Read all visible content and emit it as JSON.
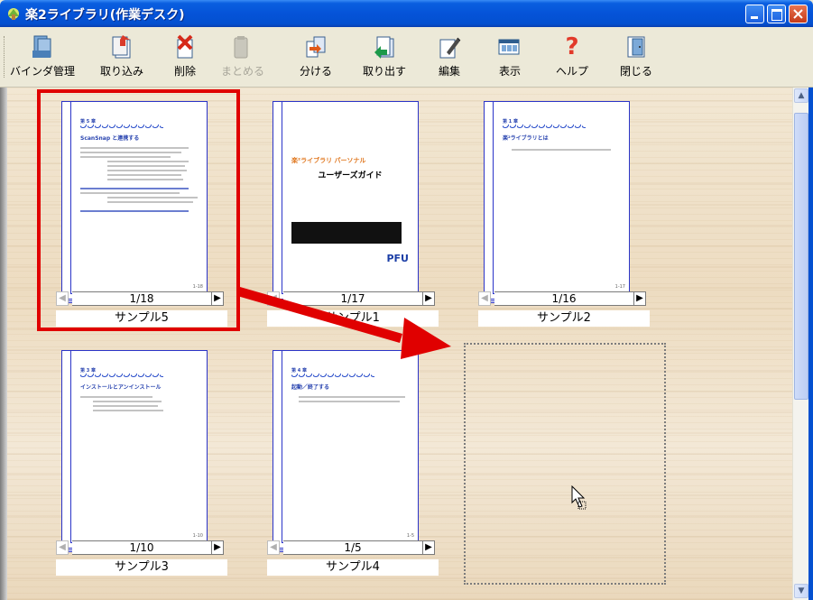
{
  "window": {
    "title": "楽2ライブラリ(作業デスク)"
  },
  "toolbar": {
    "items": [
      {
        "label": "バインダ管理",
        "icon": "binder-manage-icon",
        "enabled": true
      },
      {
        "label": "取り込み",
        "icon": "import-icon",
        "enabled": true
      },
      {
        "label": "削除",
        "icon": "delete-icon",
        "enabled": true
      },
      {
        "label": "まとめる",
        "icon": "merge-icon",
        "enabled": false
      },
      {
        "label": "分ける",
        "icon": "split-icon",
        "enabled": true
      },
      {
        "label": "取り出す",
        "icon": "extract-icon",
        "enabled": true
      },
      {
        "label": "編集",
        "icon": "edit-icon",
        "enabled": true
      },
      {
        "label": "表示",
        "icon": "view-icon",
        "enabled": true
      },
      {
        "label": "ヘルプ",
        "icon": "help-icon",
        "enabled": true
      },
      {
        "label": "閉じる",
        "icon": "close-door-icon",
        "enabled": true
      }
    ]
  },
  "binders": [
    {
      "name": "サンプル5",
      "page": "1/18",
      "selected": true,
      "cover_title": "ScanSnap と連携する"
    },
    {
      "name": "サンプル1",
      "page": "1/17",
      "selected": false,
      "cover_title": "ユーザーズガイド",
      "cover_brand": "PFU"
    },
    {
      "name": "サンプル2",
      "page": "1/16",
      "selected": false,
      "cover_title": "楽²ライブラリとは"
    },
    {
      "name": "サンプル3",
      "page": "1/10",
      "selected": false,
      "cover_title": "インストールとアンインストール"
    },
    {
      "name": "サンプル4",
      "page": "1/5",
      "selected": false,
      "cover_title": "起動／終了する"
    }
  ],
  "colors": {
    "selection": "#e00000",
    "arrow": "#e00000",
    "titlebar": "#0553d8"
  }
}
